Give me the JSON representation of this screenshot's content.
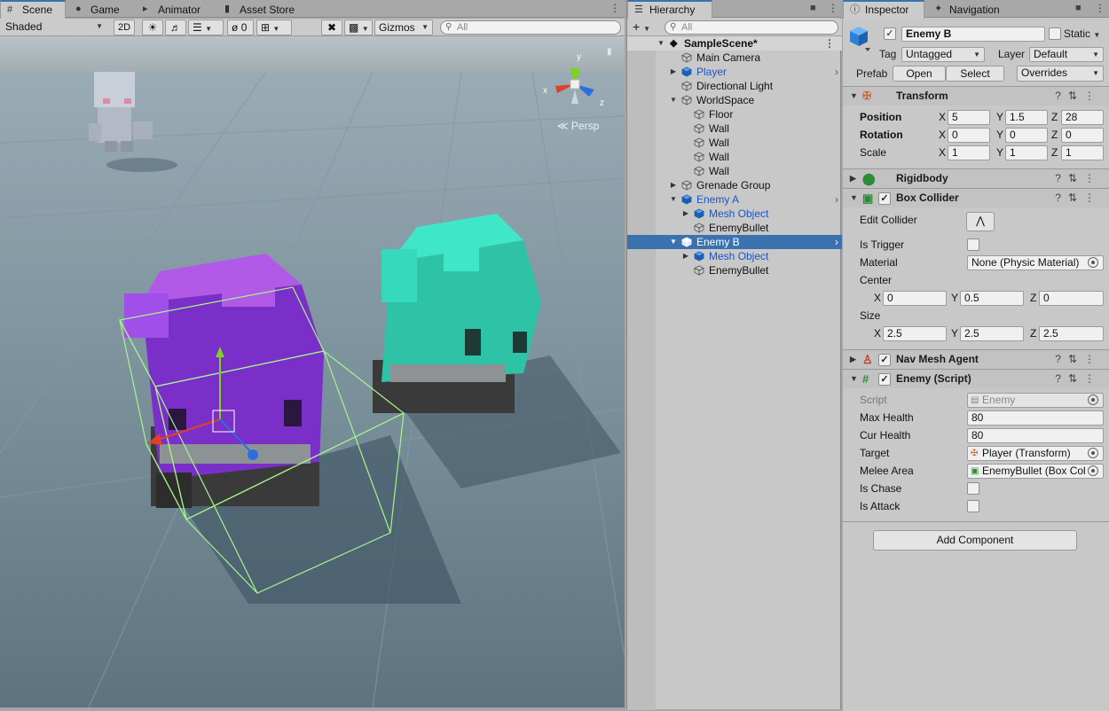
{
  "scene_tabs": {
    "tabs": [
      {
        "label": "Scene",
        "icon": "grid-icon",
        "active": true
      },
      {
        "label": "Game",
        "icon": "gamepad-icon",
        "active": false
      },
      {
        "label": "Animator",
        "icon": "animator-icon",
        "active": false
      },
      {
        "label": "Asset Store",
        "icon": "store-icon",
        "active": false
      }
    ]
  },
  "scene_toolbar": {
    "shading_mode": "Shaded",
    "mode_2d": "2D",
    "hidden_count": "0",
    "gizmos_label": "Gizmos",
    "search_placeholder": "All"
  },
  "scene_view": {
    "projection_label": "Persp",
    "gizmo_axes": {
      "x": "x",
      "y": "y",
      "z": "z"
    }
  },
  "hierarchy": {
    "tab_label": "Hierarchy",
    "search_placeholder": "All",
    "scene_name": "SampleScene*",
    "items": [
      {
        "label": "Main Camera",
        "depth": 1,
        "arrow": "",
        "blue": false,
        "chevron": false,
        "selected": false
      },
      {
        "label": "Player",
        "depth": 1,
        "arrow": "right",
        "blue": true,
        "chevron": true,
        "selected": false
      },
      {
        "label": "Directional Light",
        "depth": 1,
        "arrow": "",
        "blue": false,
        "chevron": false,
        "selected": false
      },
      {
        "label": "WorldSpace",
        "depth": 1,
        "arrow": "down",
        "blue": false,
        "chevron": false,
        "selected": false
      },
      {
        "label": "Floor",
        "depth": 2,
        "arrow": "",
        "blue": false,
        "chevron": false,
        "selected": false
      },
      {
        "label": "Wall",
        "depth": 2,
        "arrow": "",
        "blue": false,
        "chevron": false,
        "selected": false
      },
      {
        "label": "Wall",
        "depth": 2,
        "arrow": "",
        "blue": false,
        "chevron": false,
        "selected": false
      },
      {
        "label": "Wall",
        "depth": 2,
        "arrow": "",
        "blue": false,
        "chevron": false,
        "selected": false
      },
      {
        "label": "Wall",
        "depth": 2,
        "arrow": "",
        "blue": false,
        "chevron": false,
        "selected": false
      },
      {
        "label": "Grenade Group",
        "depth": 1,
        "arrow": "right",
        "blue": false,
        "chevron": false,
        "selected": false
      },
      {
        "label": "Enemy A",
        "depth": 1,
        "arrow": "down",
        "blue": true,
        "chevron": true,
        "selected": false
      },
      {
        "label": "Mesh Object",
        "depth": 2,
        "arrow": "right",
        "blue": true,
        "chevron": false,
        "selected": false
      },
      {
        "label": "EnemyBullet",
        "depth": 2,
        "arrow": "",
        "blue": false,
        "chevron": false,
        "selected": false
      },
      {
        "label": "Enemy B",
        "depth": 1,
        "arrow": "down",
        "blue": true,
        "chevron": true,
        "selected": true
      },
      {
        "label": "Mesh Object",
        "depth": 2,
        "arrow": "right",
        "blue": true,
        "chevron": false,
        "selected": false
      },
      {
        "label": "EnemyBullet",
        "depth": 2,
        "arrow": "",
        "blue": false,
        "chevron": false,
        "selected": false
      }
    ]
  },
  "inspector": {
    "tabs": [
      {
        "label": "Inspector",
        "active": true
      },
      {
        "label": "Navigation",
        "active": false
      }
    ],
    "object_name": "Enemy B",
    "static_label": "Static",
    "tag_label": "Tag",
    "tag_value": "Untagged",
    "layer_label": "Layer",
    "layer_value": "Default",
    "prefab_label": "Prefab",
    "open_label": "Open",
    "select_label": "Select",
    "overrides_label": "Overrides",
    "transform": {
      "title": "Transform",
      "position_label": "Position",
      "rotation_label": "Rotation",
      "scale_label": "Scale",
      "position": {
        "x": "5",
        "y": "1.5",
        "z": "28"
      },
      "rotation": {
        "x": "0",
        "y": "0",
        "z": "0"
      },
      "scale": {
        "x": "1",
        "y": "1",
        "z": "1"
      }
    },
    "rigidbody": {
      "title": "Rigidbody"
    },
    "box_collider": {
      "title": "Box Collider",
      "edit_collider_label": "Edit Collider",
      "is_trigger_label": "Is Trigger",
      "material_label": "Material",
      "material_value": "None (Physic Material)",
      "center_label": "Center",
      "center": {
        "x": "0",
        "y": "0.5",
        "z": "0"
      },
      "size_label": "Size",
      "size": {
        "x": "2.5",
        "y": "2.5",
        "z": "2.5"
      }
    },
    "nav_mesh_agent": {
      "title": "Nav Mesh Agent"
    },
    "enemy_script": {
      "title": "Enemy (Script)",
      "script_label": "Script",
      "script_value": "Enemy",
      "max_health_label": "Max Health",
      "max_health": "80",
      "cur_health_label": "Cur Health",
      "cur_health": "80",
      "target_label": "Target",
      "target_value": "Player (Transform)",
      "melee_area_label": "Melee Area",
      "melee_area_value": "EnemyBullet (Box Col",
      "is_chase_label": "Is Chase",
      "is_attack_label": "Is Attack"
    },
    "add_component_label": "Add Component"
  },
  "colors": {
    "accent": "#3a72b0",
    "prefab_blue": "#1a56c4",
    "enemy_b_purple": "#9a4ae0",
    "enemy_a_teal": "#3fe6c8"
  }
}
